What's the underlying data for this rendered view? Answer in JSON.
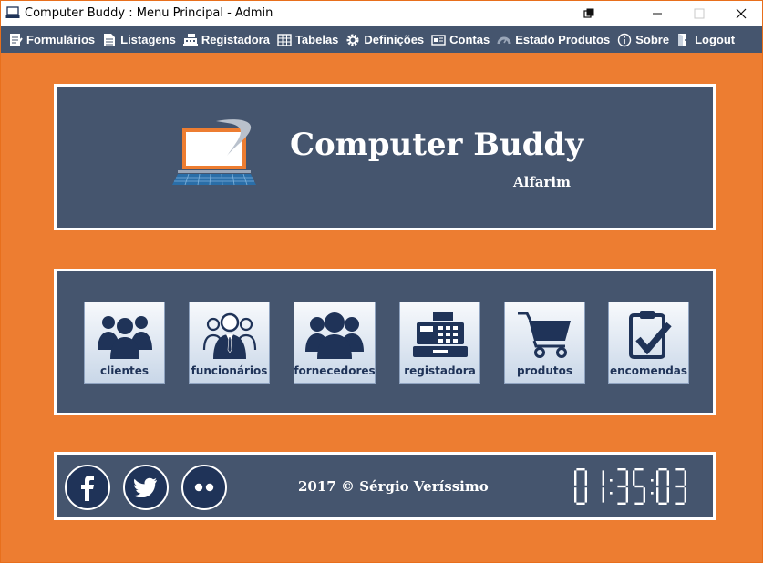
{
  "window": {
    "title": "Computer Buddy : Menu Principal - Admin",
    "controls": {
      "restore": "⧉",
      "minimize": "—",
      "maximize": "☐",
      "close": "✕"
    }
  },
  "menu": [
    {
      "label": "Formulários",
      "icon": "form-icon"
    },
    {
      "label": "Listagens",
      "icon": "list-document-icon"
    },
    {
      "label": "Registadora",
      "icon": "cash-register-icon"
    },
    {
      "label": "Tabelas",
      "icon": "table-icon"
    },
    {
      "label": "Definições",
      "icon": "gear-icon"
    },
    {
      "label": "Contas",
      "icon": "accounts-icon"
    },
    {
      "label": "Estado Produtos",
      "icon": "gauge-icon"
    },
    {
      "label": "Sobre",
      "icon": "info-icon"
    },
    {
      "label": "Logout",
      "icon": "logout-icon"
    }
  ],
  "brand": {
    "title": "Computer Buddy",
    "subtitle": "Alfarim"
  },
  "tiles": [
    {
      "label": "clientes",
      "icon": "customers-icon"
    },
    {
      "label": "funcionários",
      "icon": "employees-icon"
    },
    {
      "label": "fornecedores",
      "icon": "suppliers-icon"
    },
    {
      "label": "registadora",
      "icon": "cash-register-icon"
    },
    {
      "label": "produtos",
      "icon": "shopping-cart-icon"
    },
    {
      "label": "encomendas",
      "icon": "clipboard-check-icon"
    }
  ],
  "footer": {
    "social": [
      "facebook-icon",
      "twitter-icon",
      "flickr-icon"
    ],
    "copyright": "2017 © Sérgio Veríssimo",
    "clock": "01:35:03"
  },
  "colors": {
    "background": "#ed7d31",
    "panel": "#45556e",
    "tile_text": "#1f3358",
    "social": "#1f3358"
  }
}
